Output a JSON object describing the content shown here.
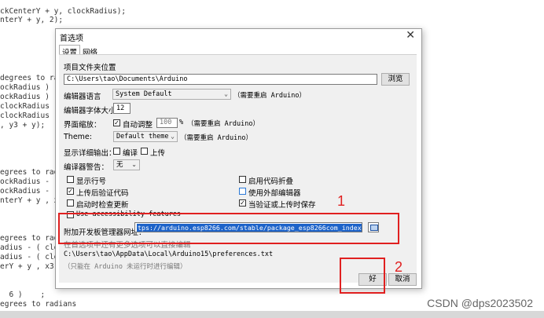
{
  "background_code": [
    {
      "text": "ckCenterY + y, clockRadius);"
    },
    {
      "text": "nterY + y, 2);"
    },
    {
      "text": "degrees to ra"
    },
    {
      "text": "ockRadius ) );"
    },
    {
      "text": "ockRadius ) );"
    },
    {
      "text": "clockRadius -"
    },
    {
      "text": "clockRadius -"
    },
    {
      "text": ", y3 + y);"
    },
    {
      "text": "egrees to radi"
    },
    {
      "text": "ockRadius - ("
    },
    {
      "text": "ockRadius - ("
    },
    {
      "text": "nterY + y , x3"
    },
    {
      "text": "egrees to radi"
    },
    {
      "text": "adius - ( cloc"
    },
    {
      "text": "adius - ( cloc"
    },
    {
      "text": "erY + y , x3"
    },
    {
      "text": "  6 )    ;"
    },
    {
      "text": "egrees to radians"
    }
  ],
  "dialog": {
    "title": "首选项",
    "close_glyph": "✕",
    "tabs": [
      "设置",
      "网络"
    ],
    "sketchbook_label": "项目文件夹位置",
    "sketchbook_path": "C:\\Users\\tao\\Documents\\Arduino",
    "browse_label": "浏览",
    "language_label": "编辑器语言",
    "language_value": "System Default",
    "language_note": "（需要重启 Arduino）",
    "font_size_label": "编辑器字体大小",
    "font_size_value": "12",
    "scale_label": "界面缩放：",
    "auto_scale_label": "自动调整",
    "scale_value": "100",
    "scale_unit": "%",
    "scale_note": "（需要重启 Arduino）",
    "theme_label": "Theme:",
    "theme_value": "Default theme",
    "theme_note": "（需要重启 Arduino）",
    "verbose_label": "显示详细输出：",
    "verbose_compile": "编译",
    "verbose_upload": "上传",
    "warnings_label": "编译器警告：",
    "warnings_value": "无",
    "options": [
      {
        "label": "显示行号",
        "checked": false
      },
      {
        "label": "启用代码折叠",
        "checked": false
      },
      {
        "label": "上传后验证代码",
        "checked": true
      },
      {
        "label": "使用外部编辑器",
        "checked": false
      },
      {
        "label": "启动时检查更新",
        "checked": false
      },
      {
        "label": "当验证或上传时保存",
        "checked": true
      },
      {
        "label": "Use accessibility features",
        "checked": false
      }
    ],
    "boards_url_label": "附加开发板管理器网址：",
    "boards_url_value": "tps://arduino.esp8266.com/stable/package_esp8266com_index.json",
    "more_prefs_note": "在首选项中还有更多选项可以直接编辑",
    "prefs_path": "C:\\Users\\tao\\AppData\\Local\\Arduino15\\preferences.txt",
    "prefs_hint": "（只能在 Arduino 未运行时进行编辑）",
    "ok_label": "好",
    "cancel_label": "取消"
  },
  "annotations": {
    "box1_number": "1",
    "box2_number": "2",
    "color": "#e02020"
  },
  "watermark": "CSDN @dps2023502"
}
